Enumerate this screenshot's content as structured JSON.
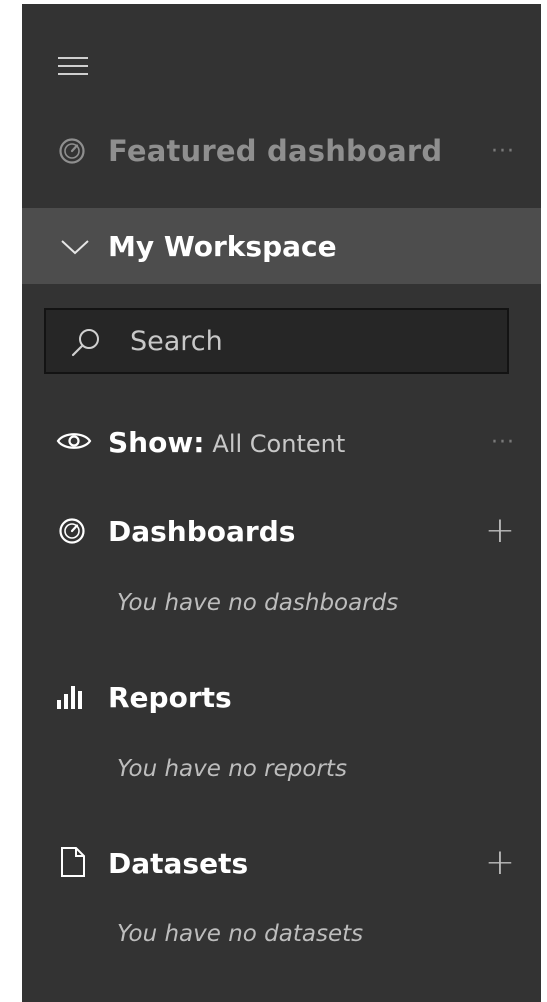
{
  "featured": {
    "label": "Featured dashboard",
    "more": "···"
  },
  "workspace": {
    "label": "My Workspace"
  },
  "search": {
    "placeholder": "Search"
  },
  "show": {
    "label": "Show:",
    "value": "All Content",
    "more": "···"
  },
  "dashboards": {
    "label": "Dashboards",
    "add": "+",
    "empty": "You have no dashboards"
  },
  "reports": {
    "label": "Reports",
    "empty": "You have no reports"
  },
  "datasets": {
    "label": "Datasets",
    "add": "+",
    "empty": "You have no datasets"
  }
}
